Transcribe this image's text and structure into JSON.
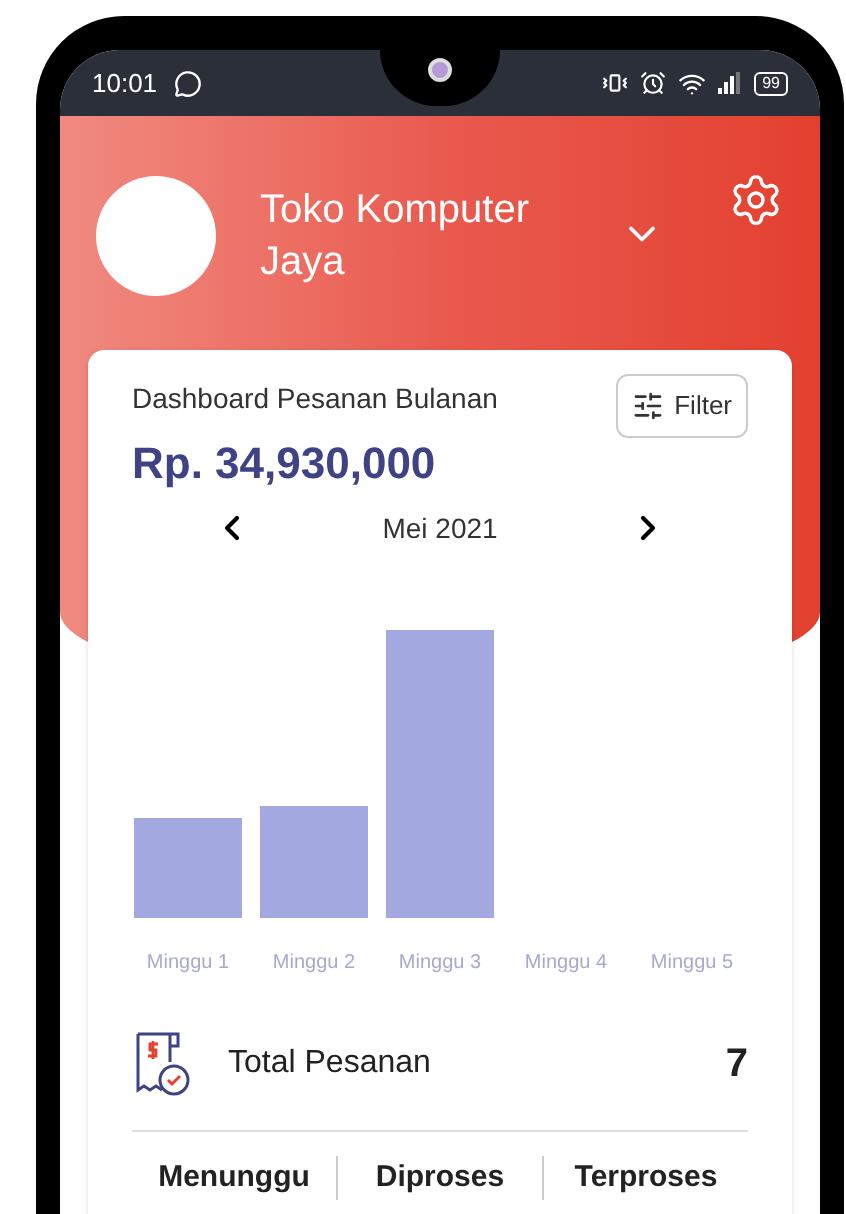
{
  "status_bar": {
    "time": "10:01",
    "battery": "99"
  },
  "store": {
    "name": "Toko Komputer Jaya"
  },
  "card": {
    "title": "Dashboard Pesanan Bulanan",
    "filter_button": "Filter",
    "amount": "Rp. 34,930,000",
    "month": "Mei 2021",
    "chart_categories": [
      "Minggu 1",
      "Minggu 2",
      "Minggu 3",
      "Minggu 4",
      "Minggu 5"
    ],
    "total": {
      "label": "Total Pesanan",
      "value": "7"
    },
    "status_tabs": [
      "Menunggu",
      "Diproses",
      "Terproses"
    ]
  }
}
